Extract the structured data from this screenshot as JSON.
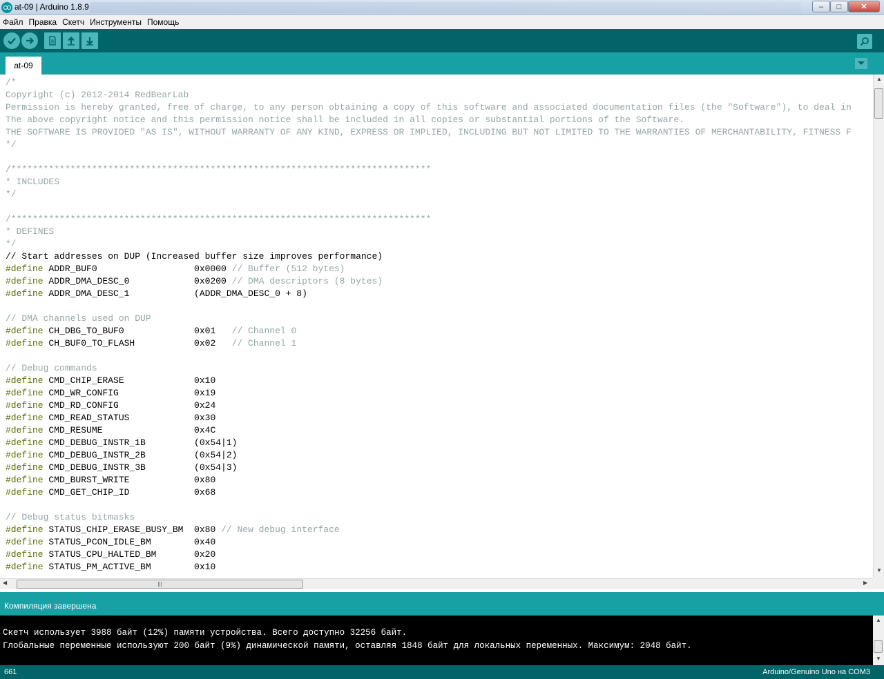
{
  "window": {
    "title": "at-09 | Arduino 1.8.9",
    "minimize_glyph": "‒",
    "maximize_glyph": "□",
    "close_glyph": "✕"
  },
  "menu": {
    "items": [
      "Файл",
      "Правка",
      "Скетч",
      "Инструменты",
      "Помощь"
    ]
  },
  "toolbar": {
    "buttons": [
      {
        "name": "verify",
        "icon": "checkmark-icon"
      },
      {
        "name": "upload",
        "icon": "arrow-right-icon"
      },
      {
        "name": "new",
        "icon": "new-file-icon"
      },
      {
        "name": "open",
        "icon": "arrow-up-icon"
      },
      {
        "name": "save",
        "icon": "arrow-down-icon"
      }
    ],
    "serial_monitor_icon": "magnifier-icon"
  },
  "tabs": {
    "active": "at-09",
    "menu_icon": "chevron-down-icon"
  },
  "editor": {
    "lines": [
      [
        [
          "cmt",
          "/*"
        ]
      ],
      [
        [
          "cmt",
          "Copyright (c) 2012-2014 RedBearLab"
        ]
      ],
      [
        [
          "cmt",
          "Permission is hereby granted, free of charge, to any person obtaining a copy of this software and associated documentation files (the \"Software\"), to deal in"
        ]
      ],
      [
        [
          "cmt",
          "The above copyright notice and this permission notice shall be included in all copies or substantial portions of the Software."
        ]
      ],
      [
        [
          "cmt",
          "THE SOFTWARE IS PROVIDED \"AS IS\", WITHOUT WARRANTY OF ANY KIND, EXPRESS OR IMPLIED, INCLUDING BUT NOT LIMITED TO THE WARRANTIES OF MERCHANTABILITY, FITNESS F"
        ]
      ],
      [
        [
          "cmt",
          "*/"
        ]
      ],
      [
        [
          "plain",
          ""
        ]
      ],
      [
        [
          "cmt",
          "/******************************************************************************"
        ]
      ],
      [
        [
          "cmt",
          "* INCLUDES"
        ]
      ],
      [
        [
          "cmt",
          "*/"
        ]
      ],
      [
        [
          "plain",
          ""
        ]
      ],
      [
        [
          "cmt",
          "/******************************************************************************"
        ]
      ],
      [
        [
          "cmt",
          "* DEFINES"
        ]
      ],
      [
        [
          "cmt",
          "*/"
        ]
      ],
      [
        [
          "plain",
          "// Start addresses on DUP (Increased buffer size improves performance)"
        ]
      ],
      [
        [
          "kw",
          "#define"
        ],
        [
          "plain",
          " ADDR_BUF0                  0x0000 "
        ],
        [
          "cmt",
          "// Buffer (512 bytes)"
        ]
      ],
      [
        [
          "kw",
          "#define"
        ],
        [
          "plain",
          " ADDR_DMA_DESC_0            0x0200 "
        ],
        [
          "cmt",
          "// DMA descriptors (8 bytes)"
        ]
      ],
      [
        [
          "kw",
          "#define"
        ],
        [
          "plain",
          " ADDR_DMA_DESC_1            (ADDR_DMA_DESC_0 + 8)"
        ]
      ],
      [
        [
          "plain",
          ""
        ]
      ],
      [
        [
          "cmt",
          "// DMA channels used on DUP"
        ]
      ],
      [
        [
          "kw",
          "#define"
        ],
        [
          "plain",
          " CH_DBG_TO_BUF0             0x01   "
        ],
        [
          "cmt",
          "// Channel 0"
        ]
      ],
      [
        [
          "kw",
          "#define"
        ],
        [
          "plain",
          " CH_BUF0_TO_FLASH           0x02   "
        ],
        [
          "cmt",
          "// Channel 1"
        ]
      ],
      [
        [
          "plain",
          ""
        ]
      ],
      [
        [
          "cmt",
          "// Debug commands"
        ]
      ],
      [
        [
          "kw",
          "#define"
        ],
        [
          "plain",
          " CMD_CHIP_ERASE             0x10"
        ]
      ],
      [
        [
          "kw",
          "#define"
        ],
        [
          "plain",
          " CMD_WR_CONFIG              0x19"
        ]
      ],
      [
        [
          "kw",
          "#define"
        ],
        [
          "plain",
          " CMD_RD_CONFIG              0x24"
        ]
      ],
      [
        [
          "kw",
          "#define"
        ],
        [
          "plain",
          " CMD_READ_STATUS            0x30"
        ]
      ],
      [
        [
          "kw",
          "#define"
        ],
        [
          "plain",
          " CMD_RESUME                 0x4C"
        ]
      ],
      [
        [
          "kw",
          "#define"
        ],
        [
          "plain",
          " CMD_DEBUG_INSTR_1B         (0x54|1)"
        ]
      ],
      [
        [
          "kw",
          "#define"
        ],
        [
          "plain",
          " CMD_DEBUG_INSTR_2B         (0x54|2)"
        ]
      ],
      [
        [
          "kw",
          "#define"
        ],
        [
          "plain",
          " CMD_DEBUG_INSTR_3B         (0x54|3)"
        ]
      ],
      [
        [
          "kw",
          "#define"
        ],
        [
          "plain",
          " CMD_BURST_WRITE            0x80"
        ]
      ],
      [
        [
          "kw",
          "#define"
        ],
        [
          "plain",
          " CMD_GET_CHIP_ID            0x68"
        ]
      ],
      [
        [
          "plain",
          ""
        ]
      ],
      [
        [
          "cmt",
          "// Debug status bitmasks"
        ]
      ],
      [
        [
          "kw",
          "#define"
        ],
        [
          "plain",
          " STATUS_CHIP_ERASE_BUSY_BM  0x80 "
        ],
        [
          "cmt",
          "// New debug interface"
        ]
      ],
      [
        [
          "kw",
          "#define"
        ],
        [
          "plain",
          " STATUS_PCON_IDLE_BM        0x40"
        ]
      ],
      [
        [
          "kw",
          "#define"
        ],
        [
          "plain",
          " STATUS_CPU_HALTED_BM       0x20"
        ]
      ],
      [
        [
          "kw",
          "#define"
        ],
        [
          "plain",
          " STATUS_PM_ACTIVE_BM        0x10"
        ]
      ]
    ]
  },
  "scrollbars": {
    "up_glyph": "▲",
    "down_glyph": "▼",
    "left_glyph": "◀",
    "right_glyph": "▶",
    "grip": "|||"
  },
  "status": {
    "message": "Компиляция завершена"
  },
  "console": {
    "lines": [
      "Скетч использует 3988 байт (12%) памяти устройства. Всего доступно 32256 байт.",
      "Глобальные переменные используют 200 байт (9%) динамической памяти, оставляя 1848 байт для локальных переменных. Максимум: 2048 байт."
    ]
  },
  "footer": {
    "line_number": "661",
    "board": "Arduino/Genuino Uno на COM3"
  }
}
